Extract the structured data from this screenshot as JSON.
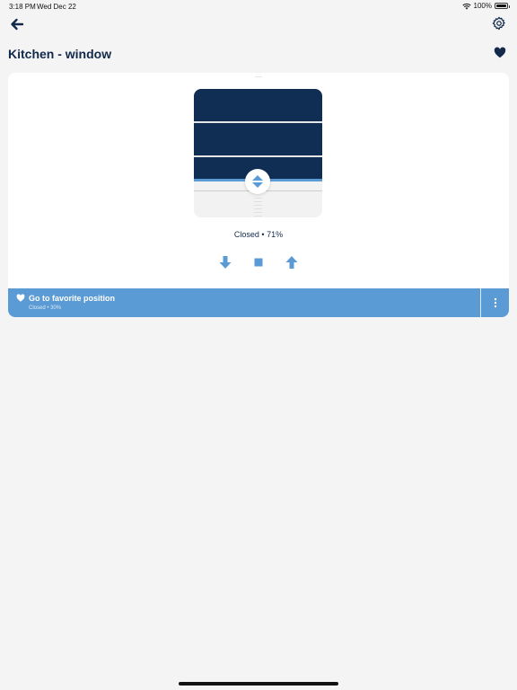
{
  "status_bar": {
    "time": "3:18 PM",
    "date": "Wed Dec 22",
    "battery": "100%",
    "icons": [
      "wifi-icon",
      "battery-icon"
    ]
  },
  "header": {
    "title": "Kitchen - window",
    "back_icon": "arrow-left-icon",
    "settings_icon": "gear-icon",
    "favorite_icon": "heart-icon"
  },
  "blind": {
    "position_percent": 71,
    "status_text": "Closed • 71%"
  },
  "controls": {
    "down_icon": "arrow-down-icon",
    "stop_icon": "stop-icon",
    "up_icon": "arrow-up-icon"
  },
  "favorite": {
    "title": "Go to favorite position",
    "subtitle": "Closed • 30%",
    "more_icon": "more-vertical-icon"
  },
  "colors": {
    "primary_navy": "#102d54",
    "accent_blue": "#5b9bd5",
    "background": "#f4f4f4"
  }
}
